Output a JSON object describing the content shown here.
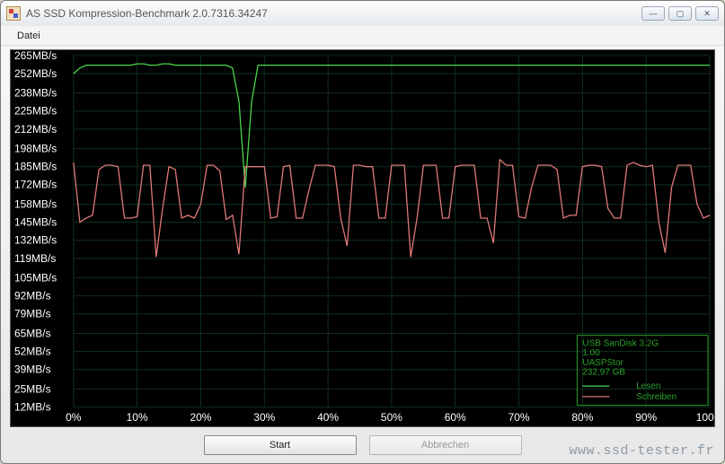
{
  "window": {
    "title": "AS SSD Kompression-Benchmark 2.0.7316.34247",
    "minimize": "—",
    "maximize": "▢",
    "close": "✕"
  },
  "menu": {
    "file": "Datei"
  },
  "buttons": {
    "start": "Start",
    "cancel": "Abbrechen"
  },
  "legend": {
    "device": "USB  SanDisk 3.2G",
    "version": "1.00",
    "driver": "UASPStor",
    "capacity": "232,97 GB",
    "read": "Lesen",
    "write": "Schreiben"
  },
  "watermark": "www.ssd-tester.fr",
  "chart_data": {
    "type": "line",
    "title": "",
    "xlabel": "",
    "ylabel": "",
    "y_unit": "MB/s",
    "y_ticks": [
      12,
      25,
      39,
      52,
      65,
      79,
      92,
      105,
      119,
      132,
      145,
      158,
      172,
      185,
      198,
      212,
      225,
      238,
      252,
      265
    ],
    "x_ticks_pct": [
      0,
      10,
      20,
      30,
      40,
      50,
      60,
      70,
      80,
      90,
      100
    ],
    "xlim": [
      0,
      100
    ],
    "ylim": [
      12,
      265
    ],
    "x": [
      0,
      1,
      2,
      3,
      4,
      5,
      6,
      7,
      8,
      9,
      10,
      11,
      12,
      13,
      14,
      15,
      16,
      17,
      18,
      19,
      20,
      21,
      22,
      23,
      24,
      25,
      26,
      27,
      28,
      29,
      30,
      31,
      32,
      33,
      34,
      35,
      36,
      37,
      38,
      39,
      40,
      41,
      42,
      43,
      44,
      45,
      46,
      47,
      48,
      49,
      50,
      51,
      52,
      53,
      54,
      55,
      56,
      57,
      58,
      59,
      60,
      61,
      62,
      63,
      64,
      65,
      66,
      67,
      68,
      69,
      70,
      71,
      72,
      73,
      74,
      75,
      76,
      77,
      78,
      79,
      80,
      81,
      82,
      83,
      84,
      85,
      86,
      87,
      88,
      89,
      90,
      91,
      92,
      93,
      94,
      95,
      96,
      97,
      98,
      99,
      100
    ],
    "series": [
      {
        "name": "Lesen",
        "color": "#49d64b",
        "values": [
          252,
          256,
          258,
          258,
          258,
          258,
          258,
          258,
          258,
          258,
          259,
          259,
          258,
          258,
          259,
          259,
          258,
          258,
          258,
          258,
          258,
          258,
          258,
          258,
          258,
          256,
          232,
          170,
          232,
          258,
          258,
          258,
          258,
          258,
          258,
          258,
          258,
          258,
          258,
          258,
          258,
          258,
          258,
          258,
          258,
          258,
          258,
          258,
          258,
          258,
          258,
          258,
          258,
          258,
          258,
          258,
          258,
          258,
          258,
          258,
          258,
          258,
          258,
          258,
          258,
          258,
          258,
          258,
          258,
          258,
          258,
          258,
          258,
          258,
          258,
          258,
          258,
          258,
          258,
          258,
          258,
          258,
          258,
          258,
          258,
          258,
          258,
          258,
          258,
          258,
          258,
          258,
          258,
          258,
          258,
          258,
          258,
          258,
          258,
          258,
          258
        ]
      },
      {
        "name": "Schreiben",
        "color": "#e07878",
        "values": [
          188,
          145,
          148,
          150,
          183,
          186,
          186,
          185,
          148,
          148,
          149,
          186,
          186,
          120,
          155,
          185,
          183,
          148,
          150,
          148,
          158,
          186,
          186,
          182,
          147,
          150,
          122,
          185,
          185,
          185,
          185,
          148,
          149,
          185,
          186,
          148,
          148,
          168,
          186,
          186,
          186,
          185,
          148,
          128,
          186,
          186,
          185,
          185,
          148,
          148,
          186,
          186,
          186,
          120,
          148,
          186,
          186,
          186,
          148,
          148,
          185,
          186,
          186,
          186,
          148,
          148,
          130,
          190,
          186,
          186,
          149,
          148,
          170,
          186,
          186,
          186,
          183,
          148,
          150,
          150,
          185,
          186,
          186,
          185,
          155,
          148,
          148,
          186,
          188,
          186,
          185,
          186,
          145,
          123,
          170,
          186,
          186,
          186,
          158,
          148,
          150
        ]
      }
    ]
  }
}
